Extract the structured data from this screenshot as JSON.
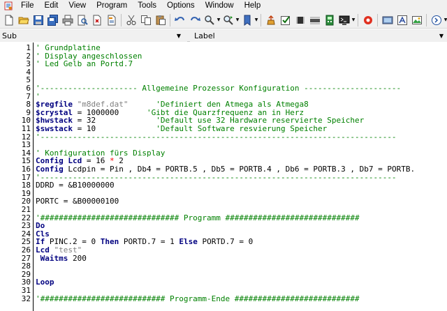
{
  "menu": {
    "items": [
      "File",
      "Edit",
      "View",
      "Program",
      "Tools",
      "Options",
      "Window",
      "Help"
    ]
  },
  "toolbar": {
    "icons": [
      "new-file-icon",
      "open-file-icon",
      "save-file-icon",
      "save-all-icon",
      "print-icon",
      "print-preview-icon",
      "find-icon",
      "close-file-icon",
      "cut-icon",
      "copy-icon",
      "paste-icon",
      "undo-icon",
      "redo-icon",
      "find-icon",
      "find-next-icon",
      "jump-icon",
      "compile-icon",
      "syntax-check-icon",
      "chip-icon",
      "program-chip-icon",
      "simulator-icon",
      "terminal-icon",
      "rename-icon",
      "lcd-designer-icon",
      "info-icon",
      "help-icon",
      "exit-icon"
    ]
  },
  "combos": {
    "sub_value": "Sub",
    "label_value": "Label"
  },
  "editor": {
    "lines": [
      {
        "n": "1",
        "parts": [
          {
            "t": "' Grundplatine",
            "c": "c-com"
          }
        ]
      },
      {
        "n": "2",
        "parts": [
          {
            "t": "' Display angeschlossen",
            "c": "c-com"
          }
        ]
      },
      {
        "n": "3",
        "parts": [
          {
            "t": "' Led Gelb an Portd.7",
            "c": "c-com"
          }
        ]
      },
      {
        "n": "4",
        "parts": []
      },
      {
        "n": "5",
        "parts": []
      },
      {
        "n": "6",
        "parts": [
          {
            "t": "'--------------------- Allgemeine Prozessor Konfiguration ---------------------",
            "c": "c-com"
          }
        ]
      },
      {
        "n": "7",
        "parts": [
          {
            "t": "'",
            "c": "c-com"
          }
        ]
      },
      {
        "n": "8",
        "parts": [
          {
            "t": "$regfile ",
            "c": "c-dir"
          },
          {
            "t": "\"m8def.dat\"",
            "c": "c-str"
          },
          {
            "t": "      ",
            "c": "c-txt"
          },
          {
            "t": "'Definiert den Atmega als Atmega8",
            "c": "c-com"
          }
        ]
      },
      {
        "n": "9",
        "parts": [
          {
            "t": "$crystal",
            "c": "c-dir"
          },
          {
            "t": " = 1000000      ",
            "c": "c-txt"
          },
          {
            "t": "'Gibt die Quarzfrequenz an in Herz",
            "c": "c-com"
          }
        ]
      },
      {
        "n": "10",
        "parts": [
          {
            "t": "$hwstack",
            "c": "c-dir"
          },
          {
            "t": " = 32             ",
            "c": "c-txt"
          },
          {
            "t": "'Default use 32 Hardware reservierte Speicher",
            "c": "c-com"
          }
        ]
      },
      {
        "n": "11",
        "parts": [
          {
            "t": "$swstack",
            "c": "c-dir"
          },
          {
            "t": " = 10             ",
            "c": "c-txt"
          },
          {
            "t": "'Default Software resvierung Speicher",
            "c": "c-com"
          }
        ]
      },
      {
        "n": "12",
        "parts": [
          {
            "t": "'-----------------------------------------------------------------------------",
            "c": "c-com"
          }
        ]
      },
      {
        "n": "13",
        "parts": []
      },
      {
        "n": "14",
        "parts": [
          {
            "t": "' Konfiguration fürs Display",
            "c": "c-com"
          }
        ]
      },
      {
        "n": "15",
        "parts": [
          {
            "t": "Config Lcd",
            "c": "c-kw"
          },
          {
            "t": " = 16 ",
            "c": "c-txt"
          },
          {
            "t": "*",
            "c": "c-red"
          },
          {
            "t": " 2",
            "c": "c-txt"
          }
        ]
      },
      {
        "n": "16",
        "parts": [
          {
            "t": "Config",
            "c": "c-kw"
          },
          {
            "t": " Lcdpin = Pin , Db4 = PORTB.5 , Db5 = PORTB.4 , Db6 = PORTB.3 , Db7 = PORTB.",
            "c": "c-txt"
          }
        ]
      },
      {
        "n": "17",
        "parts": [
          {
            "t": "'-----------------------------------------------------------------------------",
            "c": "c-com"
          }
        ]
      },
      {
        "n": "18",
        "parts": [
          {
            "t": "DDRD = ",
            "c": "c-txt"
          },
          {
            "t": "&B10000000",
            "c": "c-txt"
          }
        ]
      },
      {
        "n": "19",
        "parts": []
      },
      {
        "n": "20",
        "parts": [
          {
            "t": "PORTC = ",
            "c": "c-txt"
          },
          {
            "t": "&B00000100",
            "c": "c-txt"
          }
        ]
      },
      {
        "n": "21",
        "parts": []
      },
      {
        "n": "22",
        "parts": [
          {
            "t": "'############################## Programm #############################",
            "c": "c-com"
          }
        ]
      },
      {
        "n": "23",
        "parts": [
          {
            "t": "Do",
            "c": "c-kw"
          }
        ]
      },
      {
        "n": "24",
        "parts": [
          {
            "t": "Cls",
            "c": "c-kw"
          }
        ]
      },
      {
        "n": "25",
        "parts": [
          {
            "t": "If",
            "c": "c-kw"
          },
          {
            "t": " PINC.2 = 0 ",
            "c": "c-txt"
          },
          {
            "t": "Then",
            "c": "c-kw"
          },
          {
            "t": " PORTD.7 = 1 ",
            "c": "c-txt"
          },
          {
            "t": "Else",
            "c": "c-kw"
          },
          {
            "t": " PORTD.7 = 0",
            "c": "c-txt"
          }
        ]
      },
      {
        "n": "26",
        "parts": [
          {
            "t": "Lcd",
            "c": "c-kw"
          },
          {
            "t": " ",
            "c": "c-txt"
          },
          {
            "t": "\"test\"",
            "c": "c-str"
          }
        ]
      },
      {
        "n": "27",
        "parts": [
          {
            "t": " Waitms",
            "c": "c-kw"
          },
          {
            "t": " 200",
            "c": "c-txt"
          }
        ]
      },
      {
        "n": "28",
        "parts": []
      },
      {
        "n": "29",
        "parts": []
      },
      {
        "n": "30",
        "parts": [
          {
            "t": "Loop",
            "c": "c-kw"
          }
        ]
      },
      {
        "n": "31",
        "parts": []
      },
      {
        "n": "32",
        "parts": [
          {
            "t": "'########################### Programm-Ende ###########################",
            "c": "c-com"
          }
        ]
      }
    ]
  }
}
